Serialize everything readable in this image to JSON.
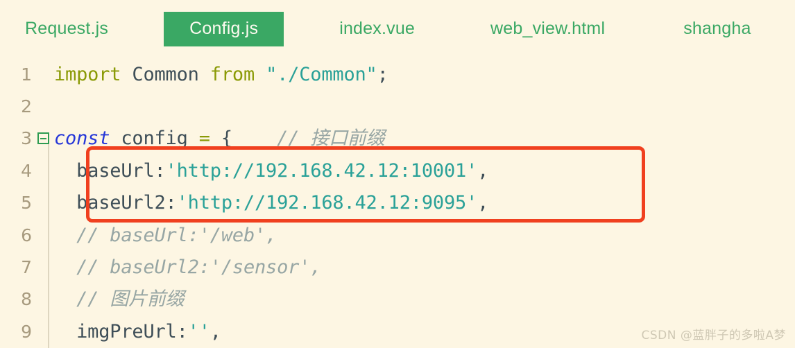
{
  "window": {
    "background_color": "#fdf6e3",
    "accent_color": "#3aa864",
    "annotation_color": "#f0401f"
  },
  "tabbar": {
    "tabs": [
      {
        "label": "Request.js",
        "active": false
      },
      {
        "label": "Config.js",
        "active": true
      },
      {
        "label": "index.vue",
        "active": false
      },
      {
        "label": "web_view.html",
        "active": false
      },
      {
        "label": "shangha",
        "active": false
      }
    ]
  },
  "editor": {
    "lines": [
      {
        "number": "1",
        "fold": false,
        "tokens": [
          {
            "text": "import ",
            "kind": "keyword2"
          },
          {
            "text": "Common ",
            "kind": "plain"
          },
          {
            "text": "from ",
            "kind": "keyword2"
          },
          {
            "text": "\"./Common\"",
            "kind": "string"
          },
          {
            "text": ";",
            "kind": "punctuation"
          }
        ]
      },
      {
        "number": "2",
        "fold": false,
        "tokens": []
      },
      {
        "number": "3",
        "fold": true,
        "tokens": [
          {
            "text": "const ",
            "kind": "keyword"
          },
          {
            "text": "config ",
            "kind": "plain"
          },
          {
            "text": "= ",
            "kind": "operator"
          },
          {
            "text": "{",
            "kind": "punctuation"
          },
          {
            "text": "    // 接口前缀",
            "kind": "comment"
          }
        ]
      },
      {
        "number": "4",
        "fold": false,
        "tokens": [
          {
            "text": "  baseUrl:",
            "kind": "plain"
          },
          {
            "text": "'http://192.168.42.12:10001'",
            "kind": "string"
          },
          {
            "text": ",",
            "kind": "punctuation"
          }
        ]
      },
      {
        "number": "5",
        "fold": false,
        "tokens": [
          {
            "text": "  baseUrl2:",
            "kind": "plain"
          },
          {
            "text": "'http://192.168.42.12:9095'",
            "kind": "string"
          },
          {
            "text": ",",
            "kind": "punctuation"
          }
        ]
      },
      {
        "number": "6",
        "fold": false,
        "tokens": [
          {
            "text": "  // baseUrl:'/web',",
            "kind": "comment"
          }
        ]
      },
      {
        "number": "7",
        "fold": false,
        "tokens": [
          {
            "text": "  // baseUrl2:'/sensor',",
            "kind": "comment"
          }
        ]
      },
      {
        "number": "8",
        "fold": false,
        "tokens": [
          {
            "text": "  // 图片前缀",
            "kind": "comment"
          }
        ]
      },
      {
        "number": "9",
        "fold": false,
        "tokens": [
          {
            "text": "  imgPreUrl:",
            "kind": "plain"
          },
          {
            "text": "''",
            "kind": "string"
          },
          {
            "text": ",",
            "kind": "punctuation"
          }
        ]
      }
    ]
  },
  "annotation": {
    "highlight_lines": [
      "4",
      "5"
    ]
  },
  "watermark": {
    "text": "CSDN @蓝胖子的多啦A梦"
  }
}
